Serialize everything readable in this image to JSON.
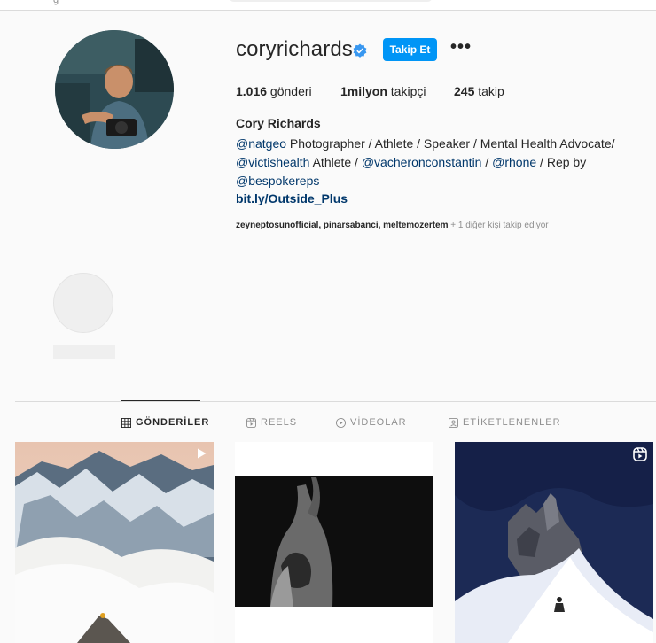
{
  "profile": {
    "username": "coryrichards",
    "follow_label": "Takip Et",
    "more_label": "•••",
    "stats": {
      "posts_count": "1.016",
      "posts_label": " gönderi",
      "followers_count": "1milyon",
      "followers_label": " takipçi",
      "following_count": "245",
      "following_label": " takip"
    },
    "full_name": "Cory Richards",
    "bio": {
      "mention1": "@natgeo",
      "text1": " Photographer / Athlete / Speaker / Mental Health Advocate/ ",
      "mention2": "@victishealth",
      "text2": " Athlete / ",
      "mention3": "@vacheronconstantin",
      "text3": " / ",
      "mention4": "@rhone",
      "text4": " / Rep by ",
      "mention5": "@bespokereps"
    },
    "link": "bit.ly/Outside_Plus",
    "followed_by": {
      "names": "zeyneptosunofficial, pinarsabanci, meltemozertem",
      "more": " + 1 diğer kişi takip ediyor"
    }
  },
  "tabs": [
    {
      "label": "GÖNDERİLER",
      "icon": "grid-icon",
      "active": true
    },
    {
      "label": "REELS",
      "icon": "reels-icon",
      "active": false
    },
    {
      "label": "VİDEOLAR",
      "icon": "play-circle-icon",
      "active": false
    },
    {
      "label": "ETİKETLENENLER",
      "icon": "tagged-icon",
      "active": false
    }
  ],
  "posts": [
    {
      "icon": "video-icon"
    },
    {
      "icon": ""
    },
    {
      "icon": "reels-icon"
    }
  ],
  "colors": {
    "accent": "#0095f6",
    "link": "#00376b",
    "verified": "#3897f0"
  }
}
